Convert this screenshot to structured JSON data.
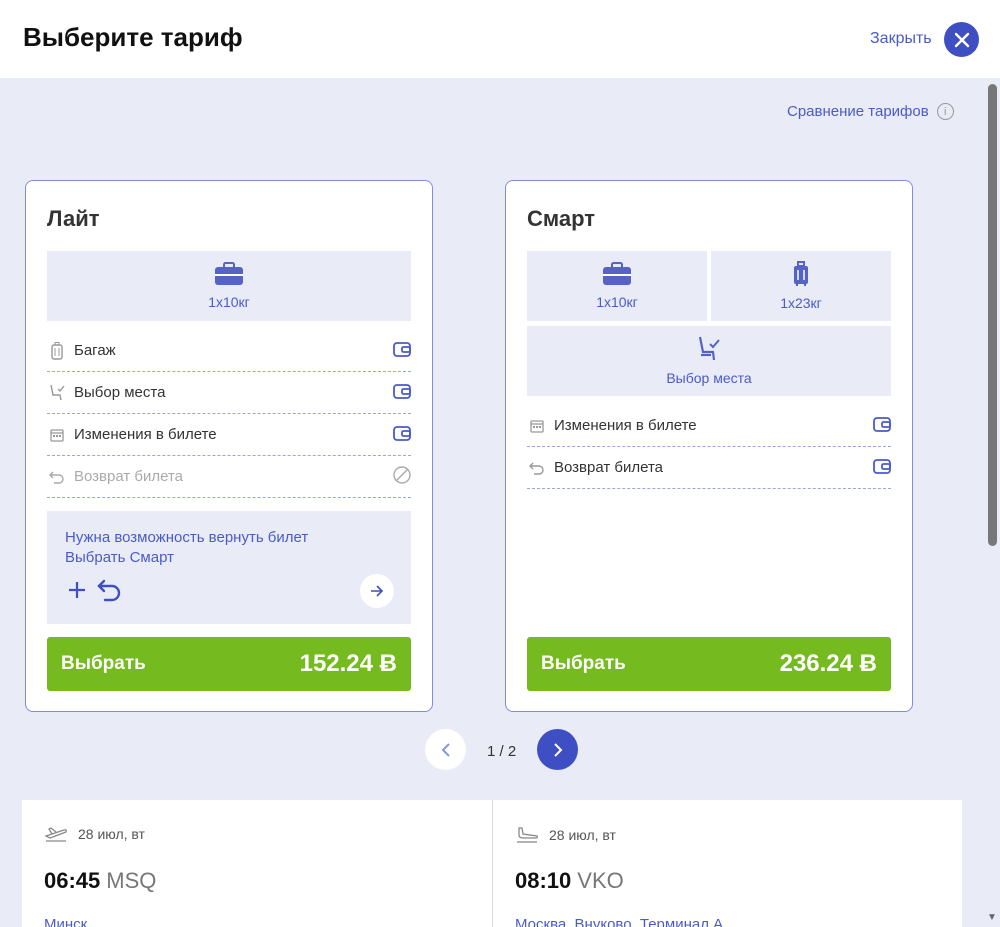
{
  "header": {
    "title": "Выберите тариф",
    "close_label": "Закрыть"
  },
  "compare_label": "Сравнение тарифов",
  "tariffs": [
    {
      "name": "Лайт",
      "tiles": [
        "1x10кг"
      ],
      "features": [
        "Багаж",
        "Выбор места",
        "Изменения в билете",
        "Возврат билета"
      ],
      "promo": {
        "line1": "Нужна возможность вернуть билет",
        "line2": "Выбрать Смарт"
      },
      "select_label": "Выбрать",
      "price": "152.24 Ƀ"
    },
    {
      "name": "Смарт",
      "tiles": [
        "1x10кг",
        "1x23кг",
        "Выбор места"
      ],
      "features": [
        "Изменения в билете",
        "Возврат билета"
      ],
      "select_label": "Выбрать",
      "price": "236.24 Ƀ"
    }
  ],
  "pager": {
    "text": "1 / 2"
  },
  "flights": {
    "departure": {
      "date": "28 июл, вт",
      "time": "06:45",
      "code": "MSQ",
      "city": "Минск"
    },
    "arrival": {
      "date": "28 июл, вт",
      "time": "08:10",
      "code": "VKO",
      "city": "Москва, Внуково, Терминал А"
    }
  },
  "colors": {
    "accent": "#3e4fc4",
    "link": "#4a5bc8",
    "cta": "#75bb1f",
    "background": "#e9ebf6"
  }
}
